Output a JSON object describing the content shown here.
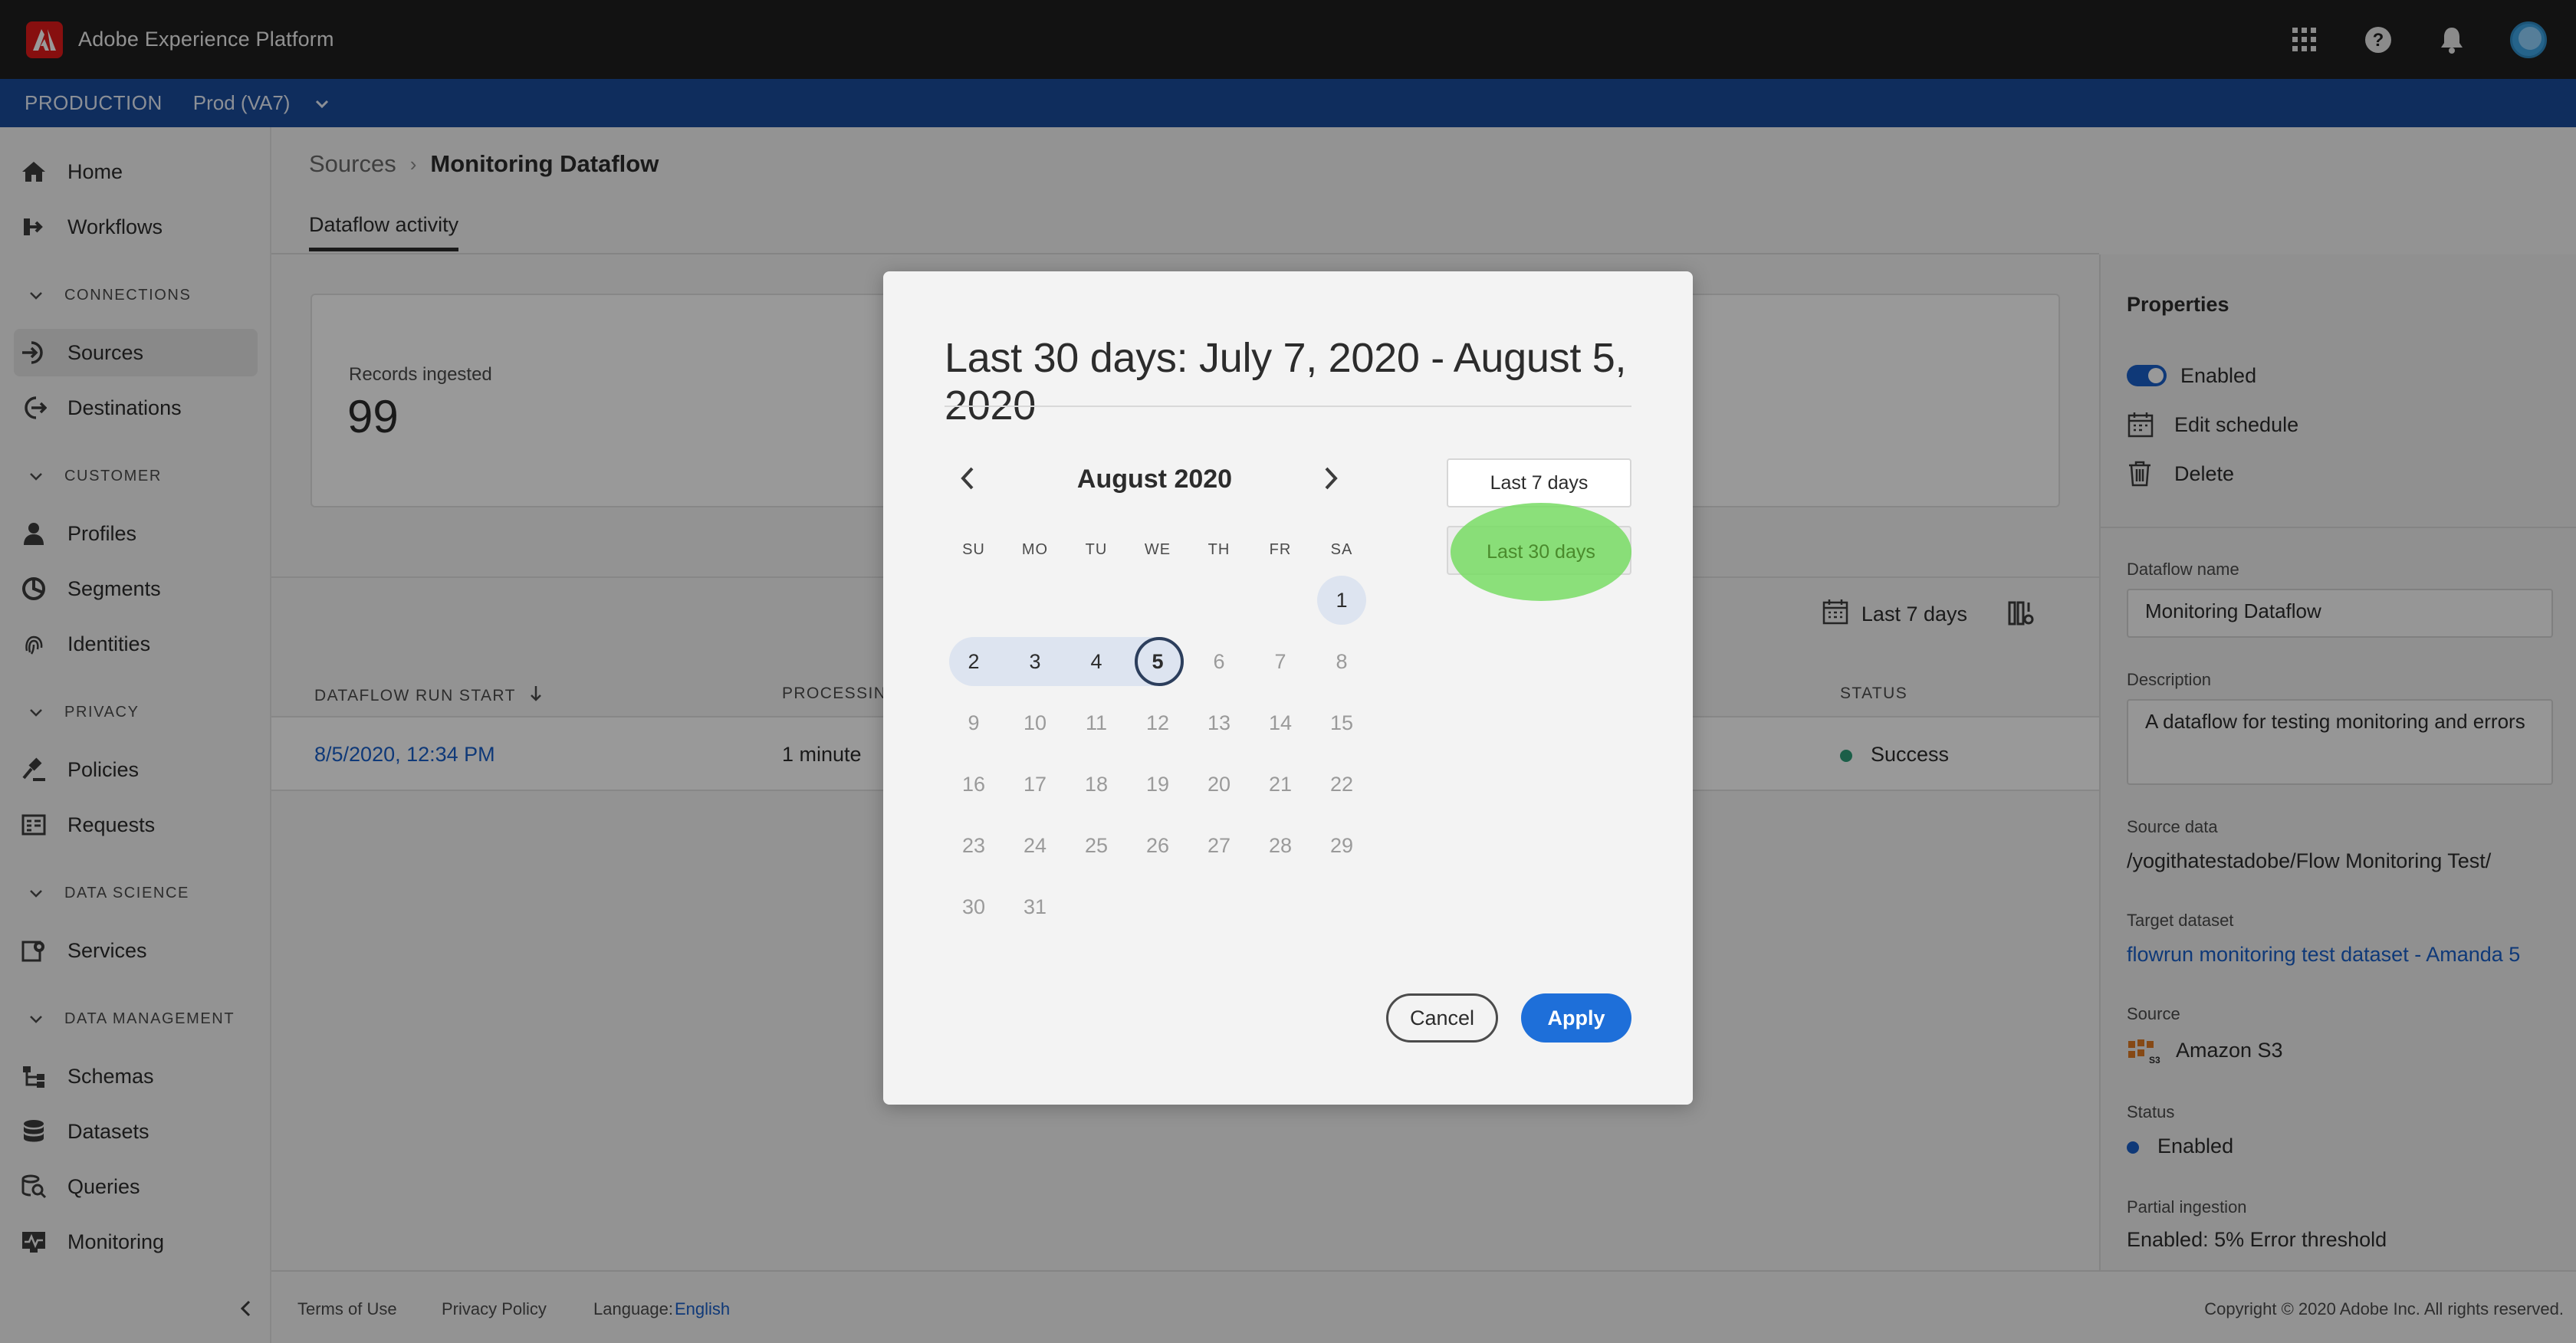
{
  "app": {
    "title": "Adobe Experience Platform"
  },
  "org": {
    "environment": "PRODUCTION",
    "sandbox": "Prod (VA7)"
  },
  "nav": {
    "home": "Home",
    "workflows": "Workflows",
    "connections_header": "CONNECTIONS",
    "sources": "Sources",
    "destinations": "Destinations",
    "customer_header": "CUSTOMER",
    "profiles": "Profiles",
    "segments": "Segments",
    "identities": "Identities",
    "privacy_header": "PRIVACY",
    "policies": "Policies",
    "requests": "Requests",
    "data_science_header": "DATA SCIENCE",
    "services": "Services",
    "data_management_header": "DATA MANAGEMENT",
    "schemas": "Schemas",
    "datasets": "Datasets",
    "queries": "Queries",
    "monitoring": "Monitoring"
  },
  "breadcrumb": {
    "parent": "Sources",
    "separator": "›",
    "current": "Monitoring Dataflow"
  },
  "tabs": {
    "activity": "Dataflow activity"
  },
  "metrics": {
    "records_label": "Records ingested",
    "records_value": "99"
  },
  "filter": {
    "range_label": "Last 7 days"
  },
  "table": {
    "headers": {
      "run_start": "DATAFLOW RUN START",
      "processing": "PROCESSING",
      "status": "STATUS"
    },
    "row": {
      "run_start": "8/5/2020, 12:34 PM",
      "processing": "1 minute",
      "status": "Success"
    }
  },
  "properties": {
    "title": "Properties",
    "enabled_label": "Enabled",
    "edit_schedule": "Edit schedule",
    "delete": "Delete",
    "dataflow_name_label": "Dataflow name",
    "dataflow_name_value": "Monitoring Dataflow",
    "description_label": "Description",
    "description_value": "A dataflow for testing monitoring and errors",
    "source_data_label": "Source data",
    "source_data_value": "/yogithatestadobe/Flow Monitoring Test/",
    "target_dataset_label": "Target dataset",
    "target_dataset_value": "flowrun monitoring test dataset - Amanda 5",
    "source_label": "Source",
    "source_value": "Amazon S3",
    "status_label": "Status",
    "status_value": "Enabled",
    "partial_label": "Partial ingestion",
    "partial_value": "Enabled: 5% Error threshold"
  },
  "footer": {
    "terms": "Terms of Use",
    "privacy": "Privacy Policy",
    "language_label": "Language:",
    "language_value": "English",
    "copyright": "Copyright © 2020 Adobe Inc. All rights reserved."
  },
  "modal": {
    "title": "Last 30 days: July 7, 2020 - August 5, 2020",
    "month": "August 2020",
    "weekdays": [
      "SU",
      "MO",
      "TU",
      "WE",
      "TH",
      "FR",
      "SA"
    ],
    "days": [
      "1",
      "2",
      "3",
      "4",
      "5",
      "6",
      "7",
      "8",
      "9",
      "10",
      "11",
      "12",
      "13",
      "14",
      "15",
      "16",
      "17",
      "18",
      "19",
      "20",
      "21",
      "22",
      "23",
      "24",
      "25",
      "26",
      "27",
      "28",
      "29",
      "30",
      "31"
    ],
    "preset_7": "Last 7 days",
    "preset_30": "Last 30 days",
    "cancel": "Cancel",
    "apply": "Apply"
  },
  "colors": {
    "shell": "#1f1f1f",
    "org_bar": "#1a4b9c",
    "accent": "#1e6fd9",
    "success": "#2d9d78",
    "highlight": "#78dc64"
  }
}
